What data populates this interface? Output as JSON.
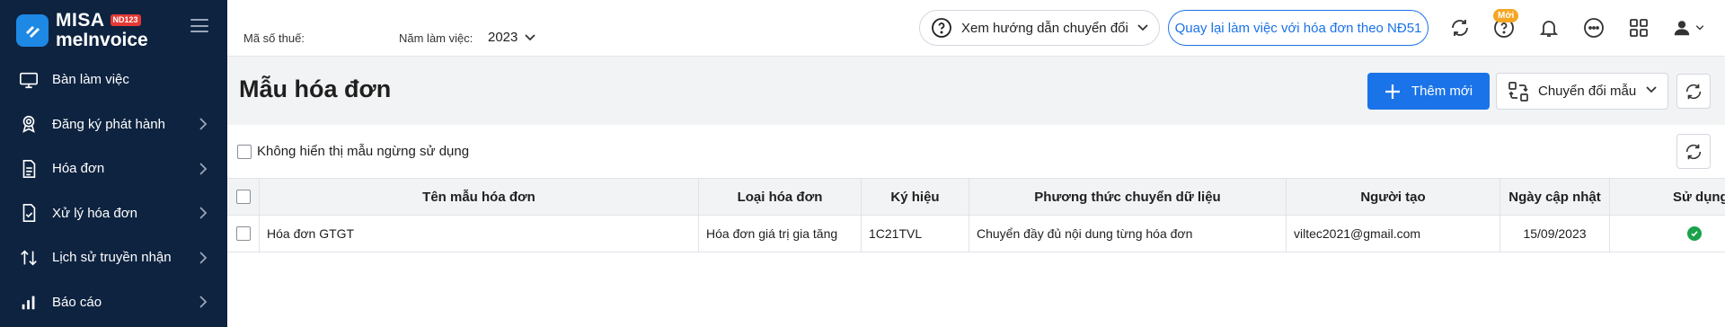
{
  "app": {
    "brand_top": "MISA",
    "brand_badge": "ND123",
    "brand_bottom": "meInvoice"
  },
  "sidebar": {
    "items": [
      {
        "label": "Bàn làm việc",
        "icon": "monitor-icon",
        "has_submenu": false
      },
      {
        "label": "Đăng ký phát hành",
        "icon": "award-icon",
        "has_submenu": true
      },
      {
        "label": "Hóa đơn",
        "icon": "document-icon",
        "has_submenu": true
      },
      {
        "label": "Xử lý hóa đơn",
        "icon": "document-check-icon",
        "has_submenu": true
      },
      {
        "label": "Lịch sử truyền nhận",
        "icon": "transfer-arrows-icon",
        "has_submenu": true
      },
      {
        "label": "Báo cáo",
        "icon": "bar-chart-icon",
        "has_submenu": true
      }
    ]
  },
  "topbar": {
    "tax_code_label": "Mã số thuế:",
    "year_label": "Năm làm việc:",
    "year_value": "2023",
    "guide_button": "Xem hướng dẫn chuyển đổi",
    "nd51_button": "Quay lại làm việc với hóa đơn theo NĐ51",
    "new_badge": "Mới",
    "icons": [
      "sync-icon",
      "help-icon",
      "bell-icon",
      "more-icon",
      "apps-grid-icon",
      "user-icon"
    ]
  },
  "page": {
    "title": "Mẫu hóa đơn",
    "add_button": "Thêm mới",
    "convert_button": "Chuyển đổi mẫu",
    "filter_label": "Không hiển thị mẫu ngừng sử dụng"
  },
  "table": {
    "headers": [
      "Tên mẫu hóa đơn",
      "Loại hóa đơn",
      "Ký hiệu",
      "Phương thức chuyển dữ liệu",
      "Người tạo",
      "Ngày cập nhật",
      "Sử dụng"
    ],
    "rows": [
      {
        "name": "Hóa đơn GTGT",
        "type": "Hóa đơn giá trị gia tăng",
        "symbol": "1C21TVL",
        "method": "Chuyển đầy đủ nội dung từng hóa đơn",
        "creator": "viltec2021@gmail.com",
        "updated": "15/09/2023",
        "in_use": true
      }
    ]
  },
  "colors": {
    "sidebar_bg": "#0e2340",
    "primary": "#1a73e8",
    "success": "#1aa34a",
    "badge_orange": "#f5a623"
  }
}
